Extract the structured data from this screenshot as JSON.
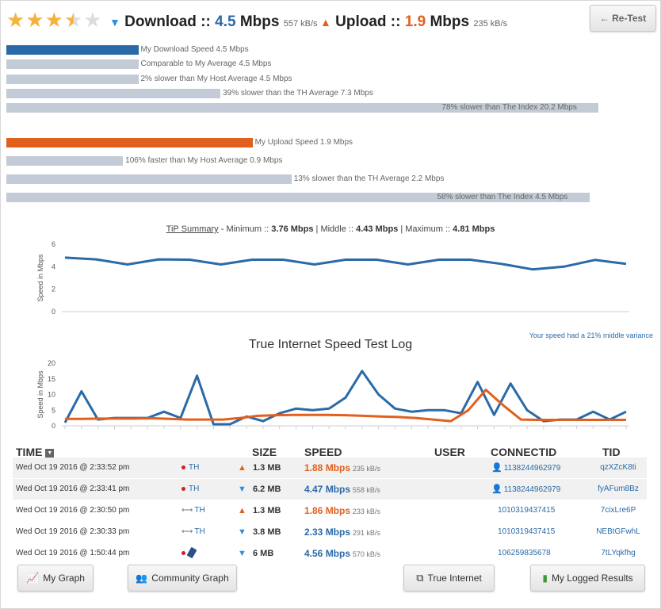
{
  "rating": {
    "stars": 3.5,
    "max": 5
  },
  "header": {
    "download_label": "Download ::",
    "download_value": "4.5",
    "download_unit": "Mbps",
    "download_kbs": "557 kB/s",
    "upload_label": "Upload ::",
    "upload_value": "1.9",
    "upload_unit": "Mbps",
    "upload_kbs": "235 kB/s",
    "retest_label": "← Re-Test"
  },
  "download_bars": [
    {
      "label": "My Download Speed 4.5 Mbps",
      "value": 4.5,
      "color": "blue"
    },
    {
      "label": "Comparable to My Average 4.5 Mbps",
      "value": 4.5,
      "color": "grey"
    },
    {
      "label": "2% slower than My Host Average 4.5 Mbps",
      "value": 4.5,
      "color": "grey"
    },
    {
      "label": "39% slower than the TH Average 7.3 Mbps",
      "value": 7.3,
      "color": "grey"
    },
    {
      "label": "78% slower than The Index 20.2 Mbps",
      "value": 20.2,
      "color": "grey"
    }
  ],
  "upload_bars": [
    {
      "label": "My Upload Speed 1.9 Mbps",
      "value": 1.9,
      "color": "orange"
    },
    {
      "label": "106% faster than My Host Average 0.9 Mbps",
      "value": 0.9,
      "color": "grey"
    },
    {
      "label": "13% slower than the TH Average 2.2 Mbps",
      "value": 2.2,
      "color": "grey"
    },
    {
      "label": "58% slower than The Index 4.5 Mbps",
      "value": 4.5,
      "color": "grey"
    }
  ],
  "summary": {
    "link": "TiP Summary",
    "min_label": " - Minimum :: ",
    "min": "3.76 Mbps",
    "mid_label": " | Middle :: ",
    "mid": "4.43 Mbps",
    "max_label": " | Maximum :: ",
    "max": "4.81 Mbps"
  },
  "variance_note": "Your speed had a 21% middle variance",
  "log_title": "True Internet Speed Test Log",
  "colors": {
    "download": "#2a6aa8",
    "upload": "#e1601d",
    "bar_grey": "#c3cbd6"
  },
  "chart_data": [
    {
      "type": "line",
      "title": "",
      "ylabel": "Speed in Mbps",
      "ylim": [
        0,
        6
      ],
      "yticks": [
        "6",
        "4",
        "2",
        "0"
      ],
      "grid": false,
      "series": [
        {
          "values": [
            4.81,
            4.65,
            4.2,
            4.65,
            4.62,
            4.2,
            4.62,
            4.62,
            4.2,
            4.62,
            4.62,
            4.2,
            4.62,
            4.62,
            4.25,
            3.76,
            4.0,
            4.6,
            4.25
          ]
        }
      ]
    },
    {
      "type": "line",
      "title": "True Internet Speed Test Log",
      "ylabel": "Speed in Mbps",
      "ylim": [
        0,
        20
      ],
      "yticks": [
        "20",
        "15",
        "10",
        "5",
        "0"
      ],
      "grid": false,
      "series": [
        {
          "values": [
            1.0,
            11.0,
            2.0,
            2.5,
            2.5,
            2.5,
            4.5,
            2.5,
            16.0,
            0.5,
            0.5,
            3.0,
            1.5,
            4.0,
            5.5,
            5.0,
            5.5,
            9.0,
            17.5,
            10.0,
            5.5,
            4.5,
            5.0,
            5.0,
            4.0,
            14.0,
            3.5,
            13.5,
            5.0,
            1.5,
            2.0,
            2.0,
            4.5,
            2.0,
            4.5
          ]
        },
        {
          "values": [
            2.2,
            2.2,
            2.3,
            2.3,
            2.3,
            2.4,
            2.2,
            2.0,
            2.0,
            2.0,
            2.5,
            3.2,
            3.4,
            3.5,
            3.5,
            3.5,
            3.4,
            3.2,
            3.0,
            2.8,
            2.5,
            2.0,
            1.5,
            5.0,
            11.5,
            6.5,
            2.0,
            1.9,
            1.9,
            1.9,
            1.9,
            1.9,
            1.9
          ]
        }
      ]
    }
  ],
  "table": {
    "headers": {
      "time": "TIME",
      "size": "SIZE",
      "speed": "SPEED",
      "user": "USER",
      "connectid": "CONNECTID",
      "tid": "TID"
    },
    "rows": [
      {
        "time": "Wed Oct 19 2016 @ 2:33:52 pm",
        "host": "TH",
        "dir": "up",
        "size": "1.3 MB",
        "speed": "1.88 Mbps",
        "kbs": "235 kB/s",
        "connectid": "1138244962979",
        "tid": "qzXZcK8ti"
      },
      {
        "time": "Wed Oct 19 2016 @ 2:33:41 pm",
        "host": "TH",
        "dir": "down",
        "size": "6.2 MB",
        "speed": "4.47 Mbps",
        "kbs": "558 kB/s",
        "connectid": "1138244962979",
        "tid": "fyAFum8Bz"
      },
      {
        "time": "Wed Oct 19 2016 @ 2:30:50 pm",
        "host": "TH",
        "dir": "up",
        "size": "1.3 MB",
        "speed": "1.86 Mbps",
        "kbs": "233 kB/s",
        "connectid": "1010319437415",
        "tid": "7cixLre6P"
      },
      {
        "time": "Wed Oct 19 2016 @ 2:30:33 pm",
        "host": "TH",
        "dir": "down",
        "size": "3.8 MB",
        "speed": "2.33 Mbps",
        "kbs": "291 kB/s",
        "connectid": "1010319437415",
        "tid": "NEBtGFwhL"
      },
      {
        "time": "Wed Oct 19 2016 @ 1:50:44 pm",
        "host": "",
        "dir": "down",
        "size": "6 MB",
        "speed": "4.56 Mbps",
        "kbs": "570 kB/s",
        "connectid": "106259835678",
        "tid": "7tLYqkfhg"
      }
    ]
  },
  "buttons": {
    "my_graph": "My Graph",
    "community_graph": "Community Graph",
    "true_internet": "True Internet",
    "my_logged_results": "My Logged Results"
  }
}
